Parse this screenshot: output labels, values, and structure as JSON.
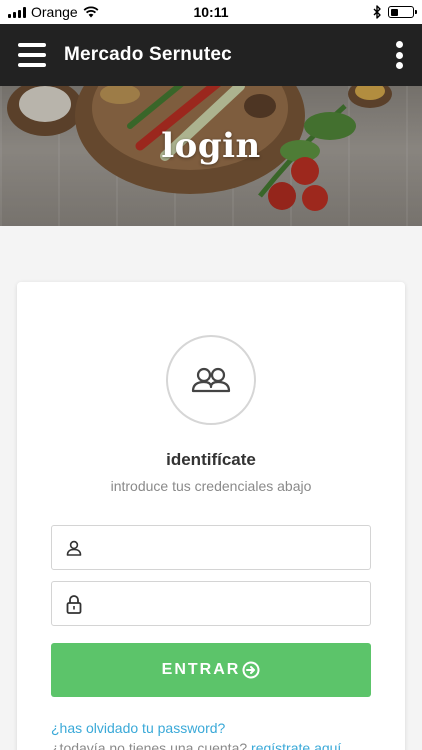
{
  "status_bar": {
    "carrier": "Orange",
    "time": "10:11",
    "battery_level": 0.35
  },
  "app_bar": {
    "title": "Mercado Sernutec",
    "menu_icon": "hamburger-menu-icon",
    "more_icon": "more-vert-icon"
  },
  "hero": {
    "title": "login"
  },
  "login_card": {
    "avatar_icon": "users-group-icon",
    "heading": "identifícate",
    "subheading": "introduce tus credenciales abajo",
    "username_icon": "user-icon",
    "username_value": "",
    "password_icon": "lock-icon",
    "password_value": "",
    "submit_label": "ENTRAR",
    "submit_icon": "arrow-circle-right-icon",
    "forgot_password_link": "¿has olvidado tu password?",
    "no_account_text": "¿todavía no tienes una cuenta?",
    "register_link": "regístrate aquí"
  },
  "colors": {
    "app_bar": "#222222",
    "accent_green": "#5cc46a",
    "link_blue": "#3aa9d8",
    "background": "#f4f4f4"
  }
}
